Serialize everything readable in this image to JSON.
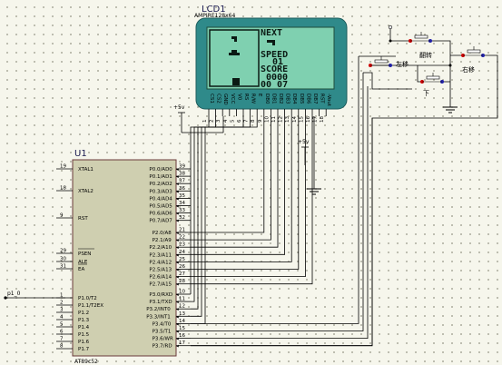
{
  "lcd": {
    "ref": "LCD1",
    "model": "AMPIRE128x64",
    "lines": [
      "NEXT",
      "SPEED",
      "01",
      "SCORE",
      "0000",
      "00 07"
    ],
    "pins": [
      "CS1",
      "CS2",
      "GND",
      "VCC",
      "V0",
      "RS",
      "R/W",
      "E",
      "DB0",
      "DB1",
      "DB2",
      "DB3",
      "DB4",
      "DB5",
      "DB6",
      "DB7",
      "RST",
      "-Vout"
    ],
    "pin_numbers": [
      "1",
      "2",
      "3",
      "4",
      "5",
      "6",
      "7",
      "8",
      "9",
      "10",
      "11",
      "12",
      "13",
      "14",
      "15",
      "16",
      "17",
      "18"
    ],
    "supply": "+5v"
  },
  "mcu": {
    "ref": "U1",
    "part": "AT89c52",
    "left_pins": [
      {
        "num": "19",
        "name": "XTAL1"
      },
      {
        "num": "18",
        "name": "XTAL2"
      },
      {
        "num": "9",
        "name": "RST"
      },
      {
        "num": "29",
        "name": "PSEN"
      },
      {
        "num": "30",
        "name": "ALE"
      },
      {
        "num": "31",
        "name": "EA"
      },
      {
        "num": "1",
        "name": "P1.0/T2"
      },
      {
        "num": "2",
        "name": "P1.1/T2EX"
      },
      {
        "num": "3",
        "name": "P1.2"
      },
      {
        "num": "4",
        "name": "P1.3"
      },
      {
        "num": "5",
        "name": "P1.4"
      },
      {
        "num": "6",
        "name": "P1.5"
      },
      {
        "num": "7",
        "name": "P1.6"
      },
      {
        "num": "8",
        "name": "P1.7"
      }
    ],
    "right_pins": [
      {
        "num": "39",
        "name": "P0.0/AD0"
      },
      {
        "num": "38",
        "name": "P0.1/AD1"
      },
      {
        "num": "37",
        "name": "P0.2/AD2"
      },
      {
        "num": "36",
        "name": "P0.3/AD3"
      },
      {
        "num": "35",
        "name": "P0.4/AD4"
      },
      {
        "num": "34",
        "name": "P0.5/AD5"
      },
      {
        "num": "33",
        "name": "P0.6/AD6"
      },
      {
        "num": "32",
        "name": "P0.7/AD7"
      },
      {
        "num": "21",
        "name": "P2.0/A8"
      },
      {
        "num": "22",
        "name": "P2.1/A9"
      },
      {
        "num": "23",
        "name": "P2.2/A10"
      },
      {
        "num": "24",
        "name": "P2.3/A11"
      },
      {
        "num": "25",
        "name": "P2.4/A12"
      },
      {
        "num": "26",
        "name": "P2.5/A13"
      },
      {
        "num": "27",
        "name": "P2.6/A14"
      },
      {
        "num": "28",
        "name": "P2.7/A15"
      },
      {
        "num": "10",
        "name": "P3.0/RXD"
      },
      {
        "num": "11",
        "name": "P3.1/TXD"
      },
      {
        "num": "12",
        "name": "P3.2/INT0"
      },
      {
        "num": "13",
        "name": "P3.3/INT1"
      },
      {
        "num": "14",
        "name": "P3.4/T0"
      },
      {
        "num": "15",
        "name": "P3.5/T1"
      },
      {
        "num": "16",
        "name": "P3.6/WR"
      },
      {
        "num": "17",
        "name": "P3.7/RD"
      }
    ]
  },
  "net_labels": {
    "supply_lcd": "+5v",
    "supply_vee": "+5v",
    "p10": "p1_0"
  },
  "buttons": {
    "rotate": "翻转",
    "left": "左移",
    "right": "右移",
    "down": "下"
  },
  "colors": {
    "lcd_frame": "#2f8a8a",
    "lcd_screen": "#7fd0b0",
    "chip_body": "#cfcfb0",
    "wire": "#000000",
    "pin_red": "#cc0000"
  }
}
